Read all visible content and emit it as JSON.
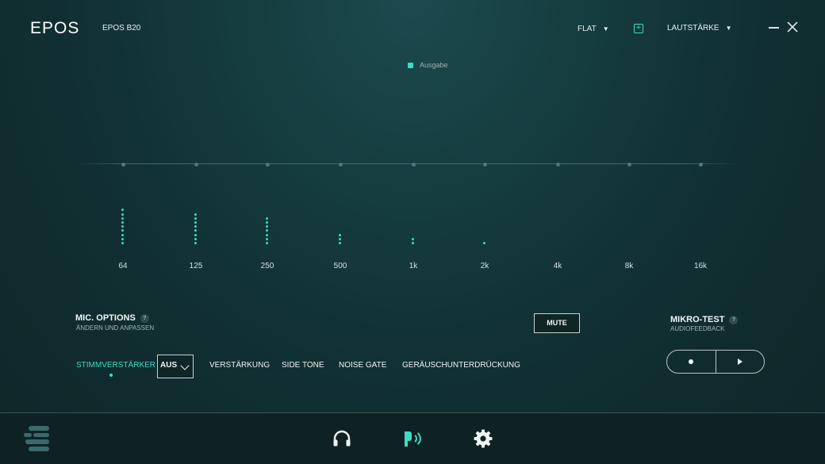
{
  "app": {
    "logo": "EPOS",
    "device_name": "EPOS B20",
    "preset_label": "FLAT",
    "preset_caret": "▼",
    "volume_label": "LAUTSTÄRKE",
    "volume_caret": "▼"
  },
  "colors": {
    "accent": "#41d9c4",
    "background": "#143a3d",
    "footer": "#0e2224"
  },
  "equalizer": {
    "legend": "Ausgabe",
    "bands": [
      {
        "label": "64",
        "level_dots": 9
      },
      {
        "label": "125",
        "level_dots": 8
      },
      {
        "label": "250",
        "level_dots": 7
      },
      {
        "label": "500",
        "level_dots": 3
      },
      {
        "label": "1k",
        "level_dots": 2
      },
      {
        "label": "2k",
        "level_dots": 1
      },
      {
        "label": "4k",
        "level_dots": 0
      },
      {
        "label": "8k",
        "level_dots": 0
      },
      {
        "label": "16k",
        "level_dots": 0
      }
    ]
  },
  "mic_options": {
    "title": "MIC. OPTIONS",
    "subtitle": "ÄNDERN UND ANPASSEN",
    "help": "?",
    "mute_label": "MUTE",
    "tabs": [
      "STIMMVERSTÄRKER",
      "VERSTÄRKUNG",
      "SIDE TONE",
      "NOISE GATE",
      "GERÄUSCHUNTERDRÜCKUNG"
    ],
    "active_tab": "STIMMVERSTÄRKER",
    "dropdown_value": "AUS"
  },
  "mic_test": {
    "title": "MIKRO-TEST",
    "subtitle": "AUDIOFEEDBACK",
    "help": "?",
    "record_icon": "record-icon",
    "play_icon": "play-icon"
  },
  "footer": {
    "icons": [
      "menu-icon",
      "headphones-icon",
      "microphone-icon",
      "settings-gear-icon"
    ],
    "active": "microphone-icon"
  }
}
